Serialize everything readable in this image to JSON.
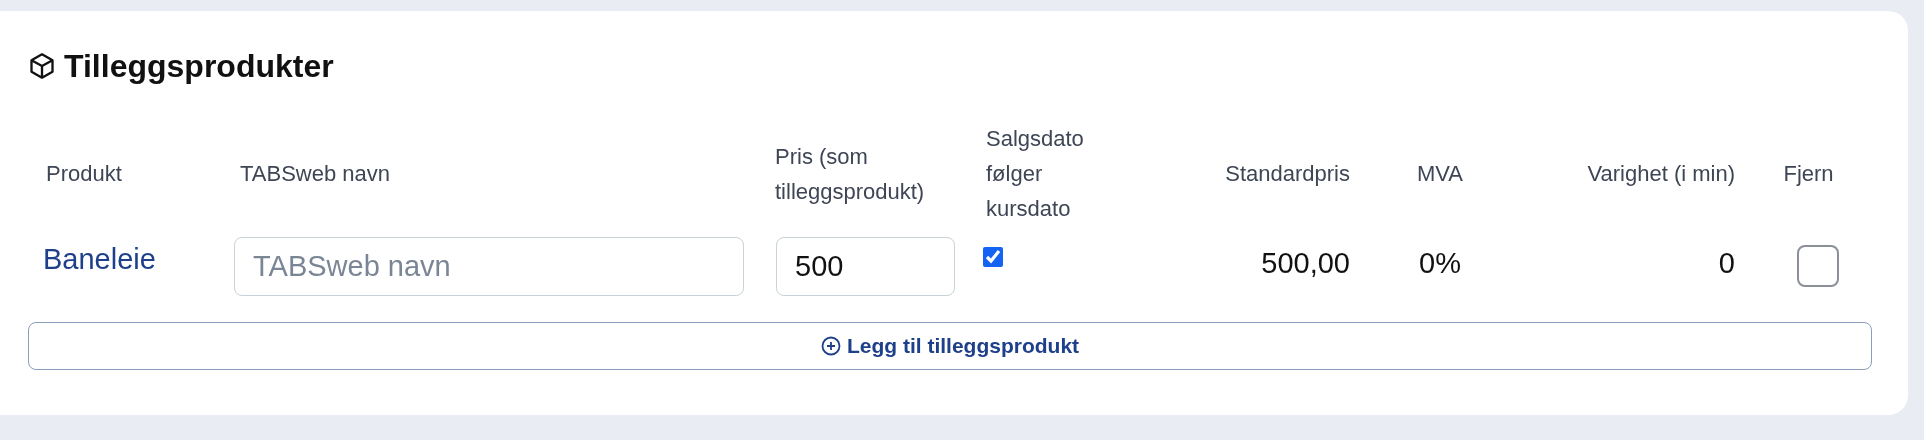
{
  "section": {
    "title": "Tilleggsprodukter"
  },
  "table": {
    "columns": [
      {
        "label": "Produkt"
      },
      {
        "label": "TABSweb navn"
      },
      {
        "label": "Pris (som tilleggsprodukt)"
      },
      {
        "label": "Salgsdato følger kursdato"
      },
      {
        "label": "Standardpris"
      },
      {
        "label": "MVA"
      },
      {
        "label": "Varighet (i min)"
      },
      {
        "label": "Fjern"
      }
    ],
    "rows": [
      {
        "product": "Baneleie",
        "tabsweb_name": {
          "placeholder": "TABSweb navn"
        },
        "price": {
          "value": "500"
        },
        "sale_date_follows": {
          "checked": true
        },
        "standard_price": "500,00",
        "vat": "0%",
        "duration": "0",
        "remove": {
          "checked": false
        }
      }
    ]
  },
  "add_button": {
    "label": "Legg til tilleggsprodukt"
  }
}
